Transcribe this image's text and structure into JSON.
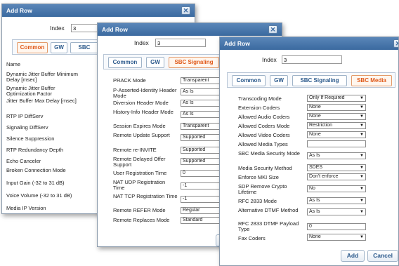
{
  "dialog1": {
    "title": "Add Row",
    "index_label": "Index",
    "index_value": "3",
    "tabs": [
      "Common",
      "GW",
      "SBC"
    ],
    "active_tab": "Common",
    "fields": [
      "Name",
      "Dynamic Jitter Buffer Minimum Delay [msec]",
      "Dynamic Jitter Buffer Optimization Factor",
      "Jitter Buffer Max Delay [msec]",
      "RTP IP DiffServ",
      "Signaling DiffServ",
      "Silence Suppression",
      "RTP Redundancy Depth",
      "Echo Canceler",
      "Broken Connection Mode",
      "Input Gain (-32 to 31 dB)",
      "Voice Volume (-32 to 31 dB)",
      "Media IP Version"
    ]
  },
  "dialog2": {
    "title": "Add Row",
    "index_label": "Index",
    "index_value": "3",
    "tabs": [
      "Common",
      "GW",
      "SBC Signaling"
    ],
    "active_tab": "SBC Signaling",
    "fields": [
      {
        "label": "PRACK Mode",
        "value": "Transparent",
        "type": "select"
      },
      {
        "label": "P-Asserted-Identity Header Mode",
        "value": "As Is",
        "type": "select"
      },
      {
        "label": "Diversion Header Mode",
        "value": "As Is",
        "type": "select"
      },
      {
        "label": "History-Info Header Mode",
        "value": "As Is",
        "type": "select"
      },
      {
        "label": "Session Expires Mode",
        "value": "Transparent",
        "type": "select"
      },
      {
        "label": "Remote Update Support",
        "value": "Supported",
        "type": "select"
      },
      {
        "label": "Remote re-INVITE",
        "value": "Supported",
        "type": "select"
      },
      {
        "label": "Remote Delayed Offer Support",
        "value": "Supported",
        "type": "select"
      },
      {
        "label": "User Registration Time",
        "value": "0",
        "type": "text"
      },
      {
        "label": "NAT UDP Registration Time",
        "value": "-1",
        "type": "text"
      },
      {
        "label": "NAT TCP Registration Time",
        "value": "-1",
        "type": "text"
      },
      {
        "label": "Remote REFER Mode",
        "value": "Regular",
        "type": "select"
      },
      {
        "label": "Remote Replaces Mode",
        "value": "Standard",
        "type": "select"
      }
    ]
  },
  "dialog3": {
    "title": "Add Row",
    "index_label": "Index",
    "index_value": "3",
    "tabs": [
      "Common",
      "GW",
      "SBC Signaling",
      "SBC Media"
    ],
    "active_tab": "SBC Media",
    "fields": [
      {
        "label": "Transcoding Mode",
        "value": "Only If Required",
        "type": "select"
      },
      {
        "label": "Extension Coders",
        "value": "None",
        "type": "select"
      },
      {
        "label": "Allowed Audio Coders",
        "value": "None",
        "type": "select"
      },
      {
        "label": "Allowed Coders Mode",
        "value": "Restriction",
        "type": "select"
      },
      {
        "label": "Allowed Video Coders",
        "value": "None",
        "type": "select"
      },
      {
        "label": "Allowed Media Types",
        "value": "",
        "type": "text"
      },
      {
        "label": "SBC Media Security Mode",
        "value": "As Is",
        "type": "select"
      },
      {
        "label": "Media Security Method",
        "value": "SDES",
        "type": "select"
      },
      {
        "label": "Enforce MKI Size",
        "value": "Don't enforce",
        "type": "select"
      },
      {
        "label": "SDP Remove Crypto Lifetime",
        "value": "No",
        "type": "select"
      },
      {
        "label": "RFC 2833 Mode",
        "value": "As Is",
        "type": "select"
      },
      {
        "label": "Alternative DTMF Method",
        "value": "As Is",
        "type": "select"
      },
      {
        "label": "RFC 2833 DTMF Payload Type",
        "value": "0",
        "type": "text"
      },
      {
        "label": "Fax Coders",
        "value": "None",
        "type": "select"
      }
    ],
    "buttons": {
      "add": "Add",
      "cancel": "Cancel"
    }
  },
  "icons": {
    "close": "close-icon",
    "dropdown": "chevron-down-icon"
  },
  "colors": {
    "title_bar": "#3b6aa0",
    "active_tab": "#e05a1a",
    "tab_text": "#2c5a8c"
  }
}
